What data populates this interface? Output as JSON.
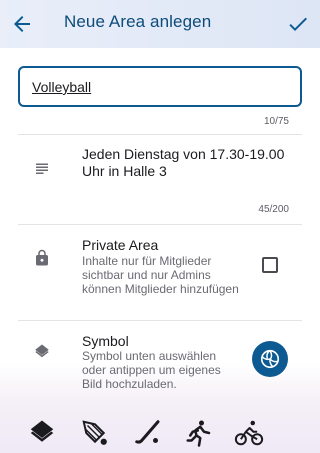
{
  "appbar": {
    "title": "Neue Area anlegen",
    "back_icon": "arrow-left-icon",
    "confirm_icon": "check-icon"
  },
  "name": {
    "value": "Volleyball",
    "counter": "10/75"
  },
  "description": {
    "icon": "notes-icon",
    "text": "Jeden Dienstag von 17.30-19.00 Uhr in Halle 3",
    "counter": "45/200"
  },
  "private": {
    "icon": "lock-icon",
    "title": "Private Area",
    "subtitle": "Inhalte nur für Mitglieder sichtbar und nur Admins können Mitglieder hinzufügen",
    "checked": false
  },
  "symbol": {
    "icon": "layers-icon",
    "title": "Symbol",
    "subtitle": "Symbol unten auswählen oder antippen um eigenes Bild hochzuladen.",
    "selected_icon": "volleyball-icon"
  },
  "symbol_options": [
    "layers-icon",
    "badminton-shuttlecock-icon",
    "hockey-stick-icon",
    "running-icon",
    "cycling-icon"
  ],
  "colors": {
    "accent": "#0d5a92",
    "title": "#0d4b7a"
  }
}
